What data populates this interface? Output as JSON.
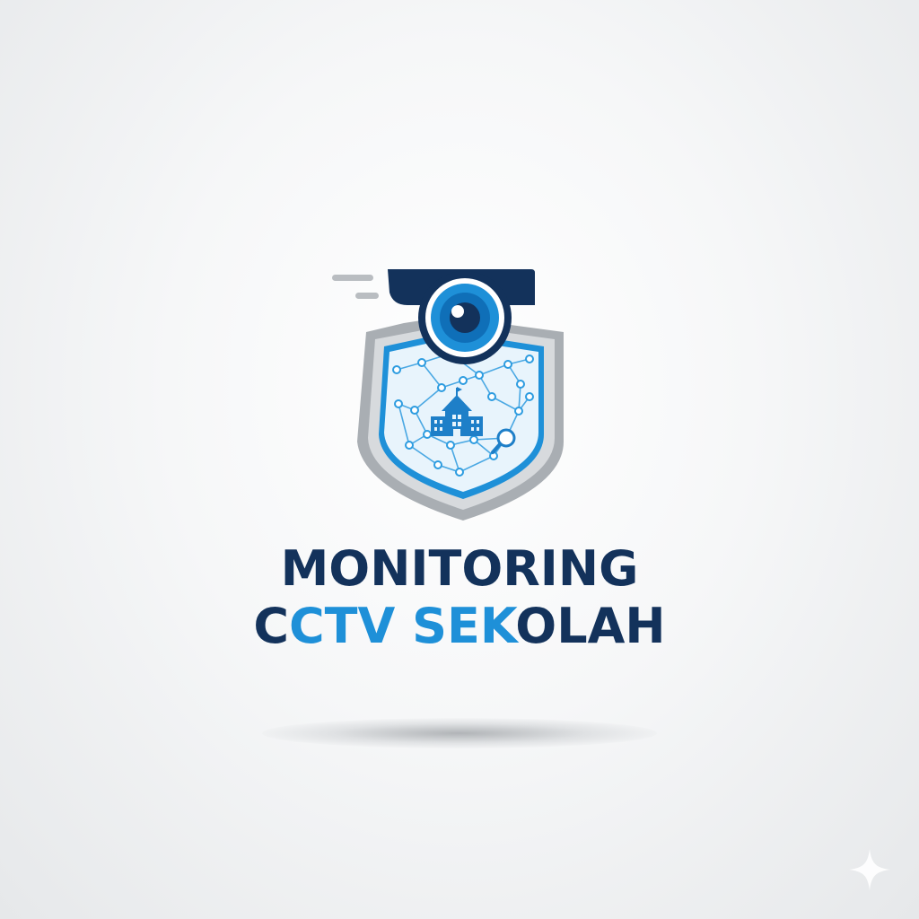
{
  "wordmark": {
    "line1": "MONITORING",
    "line2_segments": [
      {
        "text": "C",
        "tone": "dark"
      },
      {
        "text": "CTV",
        "tone": "light"
      },
      {
        "text": " ",
        "tone": "dark"
      },
      {
        "text": "SEK",
        "tone": "light"
      },
      {
        "text": "OLAH",
        "tone": "dark"
      }
    ]
  },
  "colors": {
    "navy": "#13325b",
    "blue": "#1e90d8",
    "silver": "#a9aeb3",
    "shield_fill": "#e8f4fc"
  },
  "icons": {
    "camera": "cctv-camera-icon",
    "shield": "shield-icon",
    "school": "school-building-icon",
    "search": "magnifier-icon",
    "sparkle": "sparkle-icon"
  }
}
